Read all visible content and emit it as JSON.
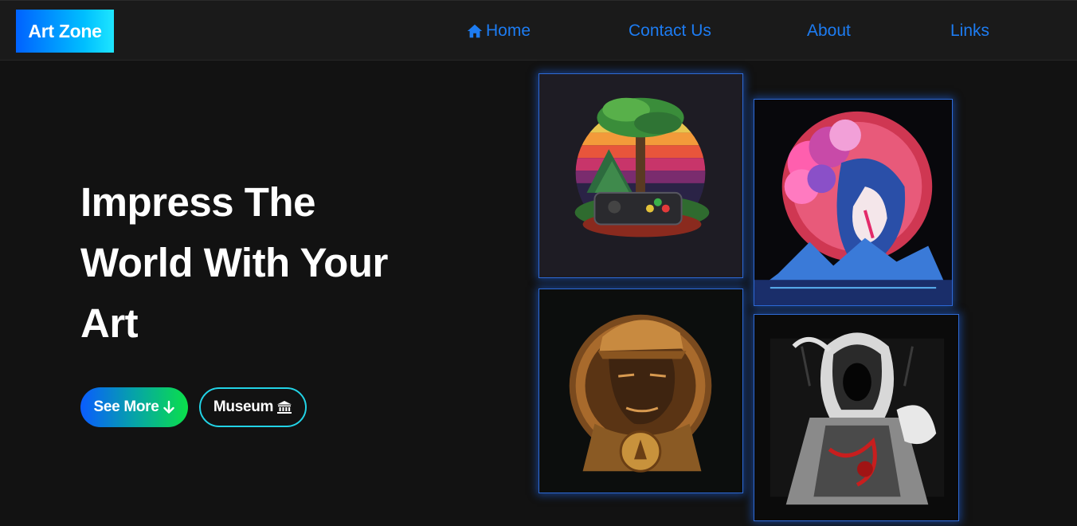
{
  "navbar": {
    "logo": "Art Zone",
    "links": [
      {
        "label": "Home",
        "icon": "home-icon"
      },
      {
        "label": "Contact Us"
      },
      {
        "label": "About"
      },
      {
        "label": "Links"
      }
    ]
  },
  "hero": {
    "headline_lines": [
      "Impress The",
      "World With Your",
      "Art"
    ],
    "buttons": [
      {
        "label": "See More",
        "icon": "arrow-down-icon"
      },
      {
        "label": "Museum",
        "icon": "museum-icon"
      }
    ]
  },
  "gallery": [
    {
      "subject": "tree on game controller illustration"
    },
    {
      "subject": "geisha with cherry blossoms illustration"
    },
    {
      "subject": "golden portrait medallion illustration"
    },
    {
      "subject": "hooded assassin illustration"
    }
  ],
  "colors": {
    "background": "#121212",
    "navbar": "#1a1a1a",
    "nav_link": "#1d7cf2",
    "accent_cyan": "#22d3e6",
    "glow_blue": "#2e6ad6"
  }
}
